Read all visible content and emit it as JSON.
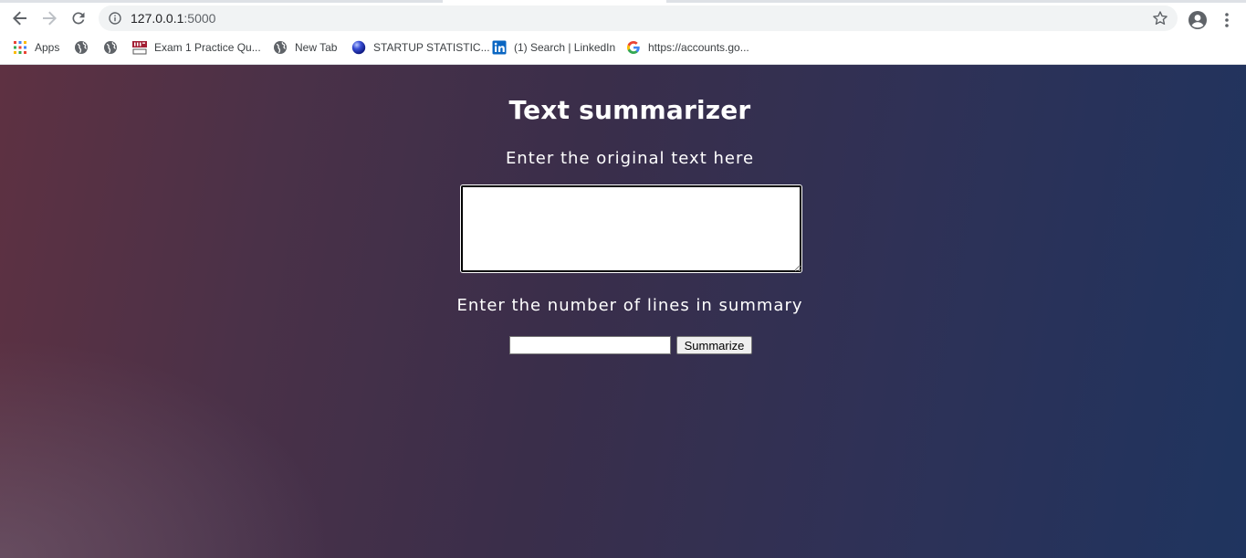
{
  "browser": {
    "url_host": "127.0.0.1",
    "url_port": ":5000",
    "bookmarks": [
      {
        "label": "Apps",
        "icon": "apps-grid-icon"
      },
      {
        "label": "",
        "icon": "globe-icon"
      },
      {
        "label": "",
        "icon": "globe-icon"
      },
      {
        "label": "Exam 1 Practice Qu...",
        "icon": "mit-ocw-icon"
      },
      {
        "label": "New Tab",
        "icon": "globe-icon"
      },
      {
        "label": "STARTUP STATISTIC...",
        "icon": "blue-sphere-icon"
      },
      {
        "label": "(1) Search | LinkedIn",
        "icon": "linkedin-icon"
      },
      {
        "label": "https://accounts.go...",
        "icon": "google-icon"
      }
    ]
  },
  "page": {
    "title": "Text summarizer",
    "original_text_label": "Enter the original text here",
    "original_text_value": "",
    "lines_label": "Enter the number of lines in summary",
    "lines_value": "",
    "summarize_button": "Summarize"
  },
  "colors": {
    "background_left": "#5e3142",
    "background_right": "#1f345f",
    "text": "#ffffff"
  }
}
